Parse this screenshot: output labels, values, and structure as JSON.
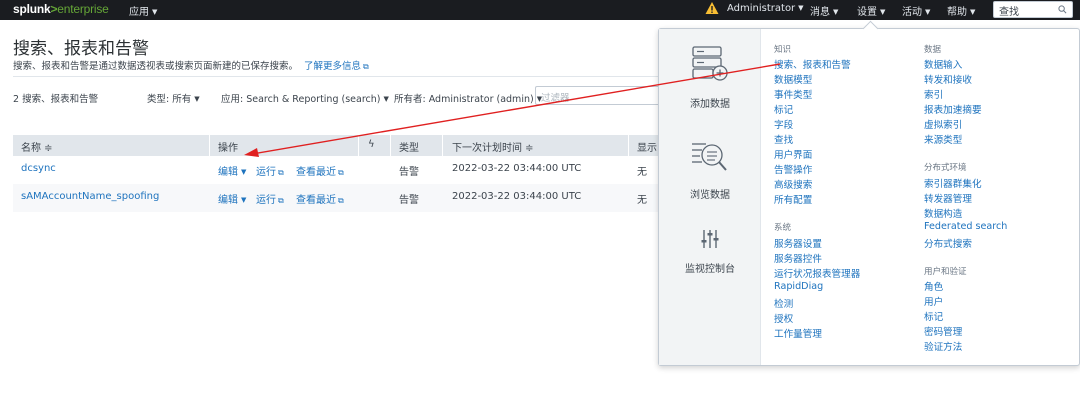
{
  "topbar": {
    "logo_main": "splunk",
    "logo_gt": ">",
    "logo_product": "enterprise",
    "apps_label": "应用",
    "user_label": "Administrator",
    "messages_label": "消息",
    "settings_label": "设置",
    "activity_label": "活动",
    "help_label": "帮助",
    "search_placeholder": "查找",
    "warning_color": "#f8be34"
  },
  "page": {
    "title": "搜索、报表和告警",
    "description": "搜索、报表和告警是通过数据透视表或搜索页面新建的已保存搜索。",
    "learn_more": "了解更多信息",
    "count_label": "2 搜索、报表和告警",
    "filters": {
      "type": "类型: 所有",
      "app": "应用: Search & Reporting (search)",
      "owner": "所有者: Administrator (admin)",
      "filter_placeholder": "过滤器"
    }
  },
  "table": {
    "headers": {
      "name": "名称 ≑",
      "actions": "操作",
      "lightning": "ϟ",
      "type": "类型",
      "next_run": "下一次计划时间 ≑",
      "display": "显示"
    },
    "rows": [
      {
        "name": "dcsync",
        "edit": "编辑",
        "run": "运行",
        "view_recent": "查看最近",
        "type": "告警",
        "next_run": "2022-03-22 03:44:00 UTC",
        "display": "无"
      },
      {
        "name": "sAMAccountName_spoofing",
        "edit": "编辑",
        "run": "运行",
        "view_recent": "查看最近",
        "type": "告警",
        "next_run": "2022-03-22 03:44:00 UTC",
        "display": "无"
      }
    ]
  },
  "settings_menu": {
    "tiles": {
      "add_data": "添加数据",
      "explore_data": "浏览数据",
      "monitoring_console": "监视控制台"
    },
    "knowledge": {
      "heading": "知识",
      "items": [
        "搜索、报表和告警",
        "数据模型",
        "事件类型",
        "标记",
        "字段",
        "查找",
        "用户界面",
        "告警操作",
        "高级搜索",
        "所有配置"
      ]
    },
    "system": {
      "heading": "系统",
      "items": [
        "服务器设置",
        "服务器控件",
        "运行状况报表管理器",
        "RapidDiag",
        "检测",
        "授权",
        "工作量管理"
      ]
    },
    "data": {
      "heading": "数据",
      "items": [
        "数据输入",
        "转发和接收",
        "索引",
        "报表加速摘要",
        "虚拟索引",
        "来源类型"
      ]
    },
    "distributed": {
      "heading": "分布式环境",
      "items": [
        "索引器群集化",
        "转发器管理",
        "数据构造",
        "Federated search",
        "分布式搜索"
      ]
    },
    "users_auth": {
      "heading": "用户和验证",
      "items": [
        "角色",
        "用户",
        "标记",
        "密码管理",
        "验证方法"
      ]
    }
  }
}
